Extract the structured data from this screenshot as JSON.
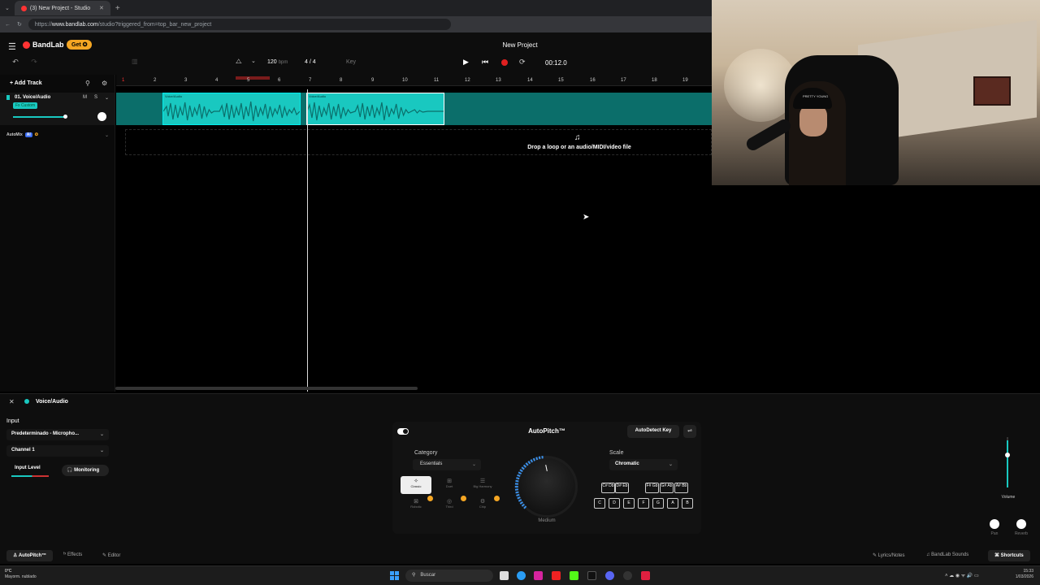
{
  "browser": {
    "tab_title": "(3) New Project - Studio",
    "url_prefix": "https://",
    "url_domain": "www.bandlab.com",
    "url_path": "/studio?triggered_from=top_bar_new_project"
  },
  "header": {
    "logo": "BandLab",
    "get_label": "Get",
    "project_title": "New Project",
    "bpm_value": "120",
    "bpm_unit": "bpm",
    "time_signature": "4 / 4",
    "key_label": "Key",
    "time_display": "00:12.0"
  },
  "tracks": {
    "add_track_label": "Add Track",
    "track1_name": "01. Voice/Audio",
    "track1_fx_tag": "Fx Custom",
    "mute_label": "M",
    "solo_label": "S",
    "automix_label": "AutoMix",
    "ai_tag": "AI"
  },
  "ruler": {
    "bars": [
      "1",
      "2",
      "3",
      "4",
      "5",
      "6",
      "7",
      "8",
      "9",
      "10",
      "11",
      "12",
      "13",
      "14",
      "15",
      "16",
      "17",
      "18",
      "19"
    ]
  },
  "clips": {
    "clip1_label": "Voice/Audio",
    "clip2_label": "Voice/Audio"
  },
  "drop_zone": {
    "text": "Drop a loop or an audio/MIDI/video file"
  },
  "bottom_panel": {
    "title": "Voice/Audio",
    "input_label": "Input",
    "input_device": "Predeterminado - Micropho...",
    "channel": "Channel 1",
    "input_level_label": "Input Level",
    "monitoring_label": "Monitoring",
    "autopitch": {
      "title": "AutoPitch™",
      "autodetect_label": "AutoDetect Key",
      "category_label": "Category",
      "category_value": "Essentials",
      "styles": [
        "Classic",
        "Duet",
        "Big Harmony",
        "Robotic",
        "Third",
        "Chip"
      ],
      "knob_label": "Medium",
      "scale_label": "Scale",
      "scale_value": "Chromatic",
      "black_keys": [
        "C# Db",
        "D# Eb",
        "F# Gb",
        "G# Ab",
        "A# Bb"
      ],
      "white_keys": [
        "C",
        "D",
        "E",
        "F",
        "G",
        "A",
        "B"
      ]
    },
    "volume_label": "Volume",
    "pan_label": "Pan",
    "reverb_label": "Reverb",
    "tabs": [
      "AutoPitch™",
      "Effects",
      "Editor"
    ],
    "right_tabs": [
      "Lyrics/Notes",
      "BandLab Sounds",
      "Shortcuts"
    ]
  },
  "webcam": {
    "cap_text": "PRETTY YOUNG"
  },
  "taskbar": {
    "temperature": "0°C",
    "weather": "Mayorm. nublado",
    "search_placeholder": "Buscar",
    "time": "15:33",
    "date": "1/03/2026"
  },
  "colors": {
    "accent": "#19c8c0",
    "record": "#e02020",
    "get_button": "#f5a623"
  }
}
